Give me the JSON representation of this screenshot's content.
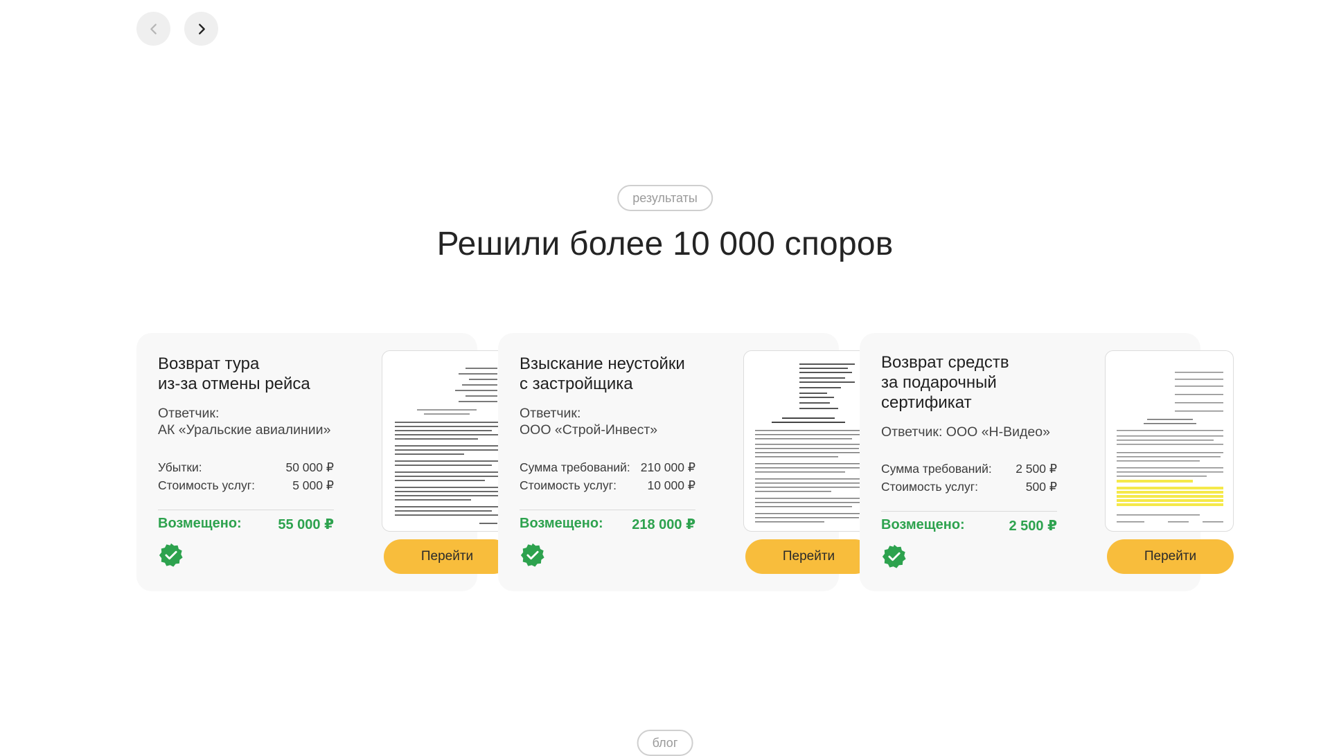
{
  "nav": {
    "prev_icon": "chevron-left-icon",
    "next_icon": "chevron-right-icon"
  },
  "section": {
    "tag": "результаты",
    "title": "Решили более 10 000 споров"
  },
  "cards": [
    {
      "title_lines": [
        "Возврат тура",
        "из-за отмены рейса"
      ],
      "respondent_lines": [
        "Ответчик:",
        "АК «Уральские авиалинии»"
      ],
      "rows": [
        {
          "label": "Убытки:",
          "value": "50 000 ₽"
        },
        {
          "label": "Стоимость услуг:",
          "value": "5 000 ₽"
        }
      ],
      "recovered_label": "Возмещено:",
      "recovered_value": "55 000 ₽",
      "button_label": "Перейти"
    },
    {
      "title_lines": [
        "Взыскание неустойки",
        "с застройщика"
      ],
      "respondent_lines": [
        "Ответчик:",
        "ООО «Строй-Инвест»"
      ],
      "rows": [
        {
          "label": "Сумма требований:",
          "value": "210 000 ₽"
        },
        {
          "label": "Стоимость услуг:",
          "value": "10 000 ₽"
        }
      ],
      "recovered_label": "Возмещено:",
      "recovered_value": "218 000 ₽",
      "button_label": "Перейти"
    },
    {
      "title_lines": [
        "Возврат средств",
        "за подарочный",
        "сертификат"
      ],
      "respondent_lines": [
        "Ответчик: ООО «Н-Видео»"
      ],
      "rows": [
        {
          "label": "Сумма требований:",
          "value": "2 500 ₽"
        },
        {
          "label": "Стоимость услуг:",
          "value": "500 ₽"
        }
      ],
      "recovered_label": "Возмещено:",
      "recovered_value": "2 500 ₽",
      "button_label": "Перейти"
    }
  ],
  "next_section": {
    "tag": "блог"
  },
  "colors": {
    "accent_button": "#f8bd3c",
    "success_green": "#2da24e",
    "badge_green": "#2da24e",
    "card_bg": "#f8f8f8"
  }
}
